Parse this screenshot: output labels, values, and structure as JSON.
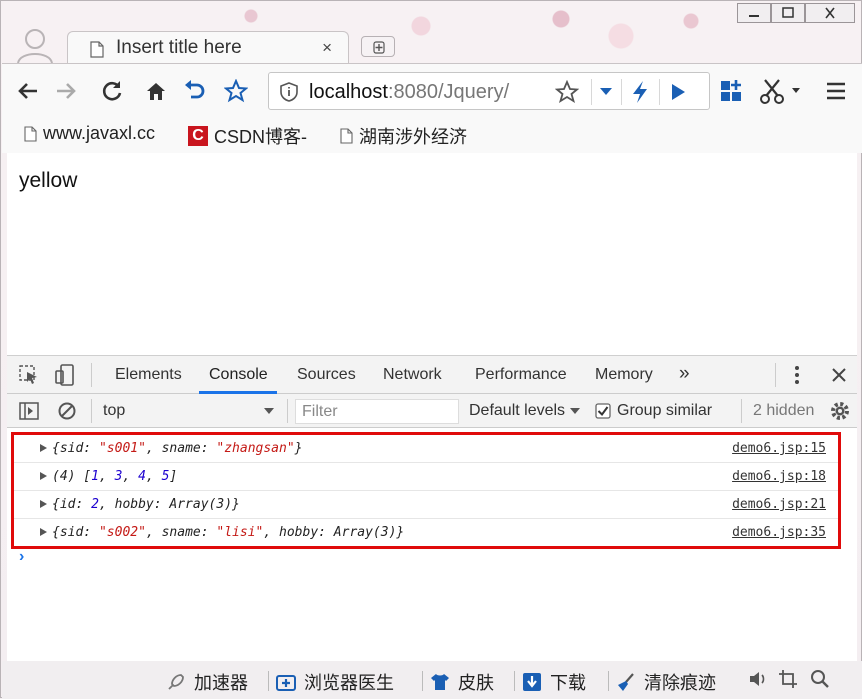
{
  "window": {
    "tab_title": "Insert title here",
    "tab_close": "×"
  },
  "toolbar": {
    "address_host": "localhost",
    "address_path": ":8080/Jquery/"
  },
  "bookmarks": [
    {
      "label": "www.javaxl.cc"
    },
    {
      "label": "CSDN博客-"
    },
    {
      "label": "湖南涉外经济"
    }
  ],
  "page": {
    "text": "yellow"
  },
  "devtools": {
    "tabs": [
      "Elements",
      "Console",
      "Sources",
      "Network",
      "Performance",
      "Memory"
    ],
    "more_tabs": "»",
    "context": "top",
    "filter_placeholder": "Filter",
    "levels": "Default levels",
    "group_similar": "Group similar",
    "hidden_count": "2 hidden",
    "logs": [
      {
        "source": "demo6.jsp:15"
      },
      {
        "source": "demo6.jsp:18"
      },
      {
        "source": "demo6.jsp:21"
      },
      {
        "source": "demo6.jsp:35"
      }
    ],
    "log_text": {
      "r1": {
        "open": "{sid: ",
        "v1": "\"s001\"",
        "mid": ", sname: ",
        "v2": "\"zhangsan\"",
        "close": "}"
      },
      "r2": {
        "prefix": "(4) [",
        "n1": "1",
        "n2": "3",
        "n3": "4",
        "n4": "5",
        "close": "]",
        "comma": ", "
      },
      "r3": {
        "open": "{id: ",
        "n1": "2",
        "rest": ", hobby: Array(3)}"
      },
      "r4": {
        "open": "{sid: ",
        "v1": "\"s002\"",
        "mid": ", sname: ",
        "v2": "\"lisi\"",
        "rest": ", hobby: Array(3)}"
      }
    },
    "prompt": "›"
  },
  "statusbar": {
    "items": [
      "加速器",
      "浏览器医生",
      "皮肤",
      "下载",
      "清除痕迹"
    ]
  },
  "colors": {
    "accent": "#1a73e8",
    "highlight_box": "#e00a0a",
    "string": "#c41a16",
    "number": "#1c00cf"
  }
}
